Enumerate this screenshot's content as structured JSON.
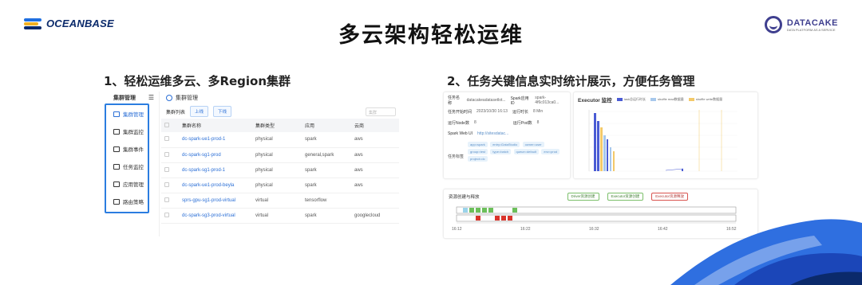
{
  "header": {
    "left_logo": "OCEANBASE",
    "title": "多云架构轻松运维",
    "right_logo": "DATACAKE",
    "right_logo_tagline": "DATA PLATFORM AS A SERVICE"
  },
  "sections": {
    "left_title": "1、轻松运维多云、多Region集群",
    "right_title": "2、任务关键信息实时统计展示，方便任务管理"
  },
  "left_screen": {
    "sidebar_title": "集群管理",
    "sidebar_items": [
      {
        "label": "集群管理",
        "active": true
      },
      {
        "label": "集群监控",
        "active": false
      },
      {
        "label": "集群事件",
        "active": false
      },
      {
        "label": "任务监控",
        "active": false
      },
      {
        "label": "应用管理",
        "active": false
      },
      {
        "label": "路由策略",
        "active": false
      }
    ],
    "breadcrumb": "集群管理",
    "toolbar": {
      "list_label": "集群列表",
      "online_button": "上线",
      "offline_button": "下线",
      "search_placeholder": "集群"
    },
    "table": {
      "headers": [
        "集群名称",
        "集群类型",
        "应用",
        "云商"
      ],
      "rows": [
        {
          "name": "dc-spark-ue1-prod-1",
          "type": "physical",
          "app": "spark",
          "cloud": "aws"
        },
        {
          "name": "dc-spark-sg1-prod",
          "type": "physical",
          "app": "general,spark",
          "cloud": "aws"
        },
        {
          "name": "dc-spark-sg1-prod-1",
          "type": "physical",
          "app": "spark",
          "cloud": "aws"
        },
        {
          "name": "dc-spark-ue1-prod-beyla",
          "type": "physical",
          "app": "spark",
          "cloud": "aws"
        },
        {
          "name": "sprs-gpu-sg1-prod-virtual",
          "type": "virtual",
          "app": "tensorflow",
          "cloud": ""
        },
        {
          "name": "dc-spark-sg3-prod-virtual",
          "type": "virtual",
          "app": "spark",
          "cloud": "googlecloud"
        }
      ]
    }
  },
  "right_screen": {
    "info": {
      "task_name_label": "任务名称",
      "task_name_value": "datacakeadatasetlot...",
      "spark_app_label": "Spark应用ID",
      "spark_app_value": "spark-4f6c013ca0...",
      "start_time_label": "任务开始时间",
      "start_time_value": "2023/10/30 16:13",
      "duration_label": "运行时长",
      "duration_value": "8 Min",
      "node_label": "运行Node数",
      "node_value": "8",
      "pod_label": "运行Pod数",
      "pod_value": "8",
      "webui_label": "Spark Web UI",
      "webui_value": "http://sitesdatac...",
      "tags_label": "任务标签",
      "tags": [
        "app=spark",
        "entry=DataStudio",
        "owner=user",
        "group=test",
        "type=batch",
        "queue=default",
        "env=prod",
        "project=dc"
      ]
    },
    "executor": {
      "title": "Executor 监控",
      "legend": [
        "task总运行时长",
        "shuffle read数据量",
        "shuffle write数据量"
      ],
      "colors": [
        "#4a5bd4",
        "#f3c96a",
        "#a7c8ec"
      ]
    },
    "timeline": {
      "label": "资源创建与释放",
      "driver_pill": "Driver资源创建",
      "exec_create_pill": "Executor资源创建",
      "exec_release_pill": "Executor资源释放",
      "ticks": [
        "16:12",
        "16:22",
        "16:32",
        "16:42",
        "16:52"
      ]
    }
  }
}
